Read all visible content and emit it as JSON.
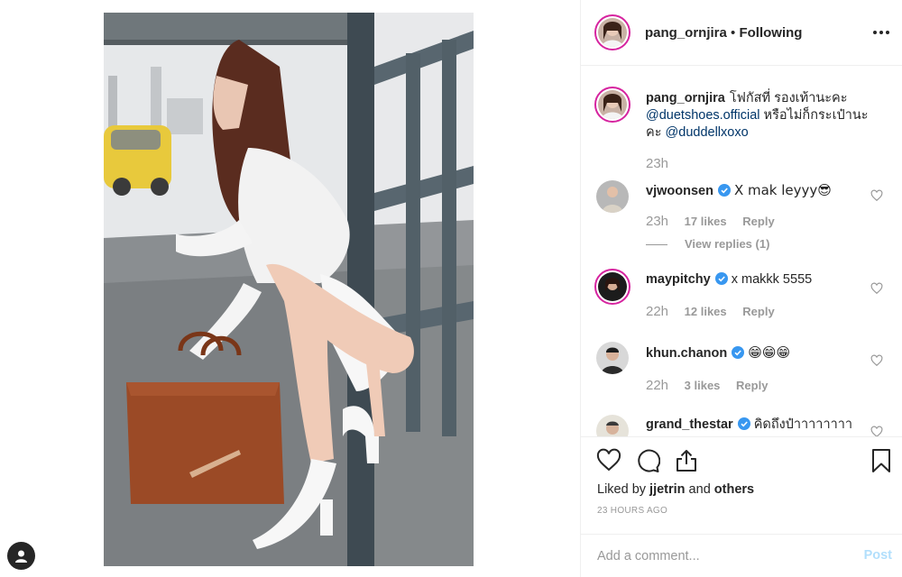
{
  "post": {
    "username": "pang_ornjira",
    "follow_separator": " • ",
    "follow_state": "Following",
    "caption_lines": [
      "โฟกัสที่ รองเท้านะคะ",
      "@duetshoes.official",
      " หรือไม่ก็กระเป๋านะคะ ",
      "@duddellxoxo"
    ],
    "caption_time": "23h"
  },
  "comments": [
    {
      "username": "vjwoonsen",
      "verified": true,
      "text": "X mak leyyy😎",
      "time": "23h",
      "likes": "17 likes",
      "reply": "Reply",
      "view_replies": "View replies (1)"
    },
    {
      "username": "maypitchy",
      "verified": true,
      "text": "x makkk 5555",
      "time": "22h",
      "likes": "12 likes",
      "reply": "Reply"
    },
    {
      "username": "khun.chanon",
      "verified": true,
      "text": "😁😁😁",
      "time": "22h",
      "likes": "3 likes",
      "reply": "Reply"
    },
    {
      "username": "grand_thestar",
      "verified": true,
      "text": "คิดถึงป๋าาาาาาาา"
    }
  ],
  "actions": {
    "liked_by_prefix": "Liked by ",
    "liked_by_user": "jjetrin",
    "liked_by_mid": " and ",
    "liked_by_others": "others",
    "timestamp": "23 HOURS AGO"
  },
  "add_comment": {
    "placeholder": "Add a comment...",
    "post_label": "Post"
  },
  "icons": {
    "more": "more-options-icon",
    "like": "heart-icon",
    "comment": "comment-icon",
    "share": "share-icon",
    "save": "bookmark-icon",
    "verified": "verified-badge-icon",
    "profile": "user-icon"
  },
  "colors": {
    "link": "#003569",
    "muted": "#999999",
    "post_button_disabled": "#b2dffc",
    "verified": "#3897f0",
    "story_ring": "#d6249f"
  }
}
